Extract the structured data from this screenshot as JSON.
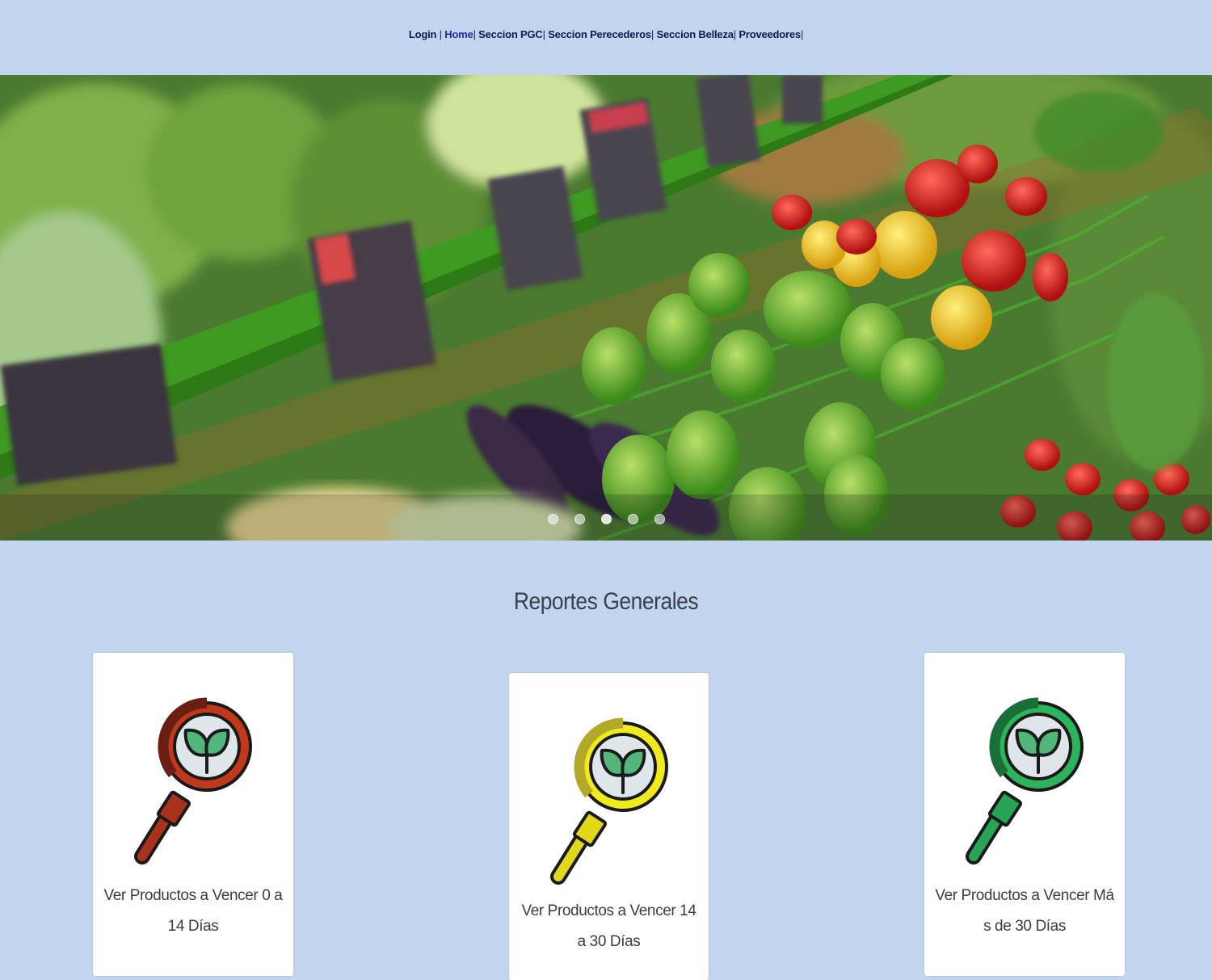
{
  "nav": {
    "items": [
      {
        "label": "Login",
        "sep": " | "
      },
      {
        "label": "Home",
        "sep": "| "
      },
      {
        "label": "Seccion PGC",
        "sep": "| "
      },
      {
        "label": "Seccion Perecederos",
        "sep": "| "
      },
      {
        "label": "Seccion Belleza",
        "sep": "| "
      },
      {
        "label": "Proveedores",
        "sep": "|"
      }
    ]
  },
  "hero": {
    "slides": 5,
    "active_slide": 3
  },
  "main": {
    "title": "Reportes Generales",
    "cards": [
      {
        "label": "Ver Productos a Vencer 0 a 14 Días",
        "icon": "magnifier-plant-icon",
        "color": "#c0391b"
      },
      {
        "label": "Ver Productos a Vencer 14 a 30 Días",
        "icon": "magnifier-plant-icon",
        "color": "#e8e21a"
      },
      {
        "label": "Ver Productos a Vencer Más de 30 Días",
        "icon": "magnifier-plant-icon",
        "color": "#28a455"
      }
    ]
  }
}
